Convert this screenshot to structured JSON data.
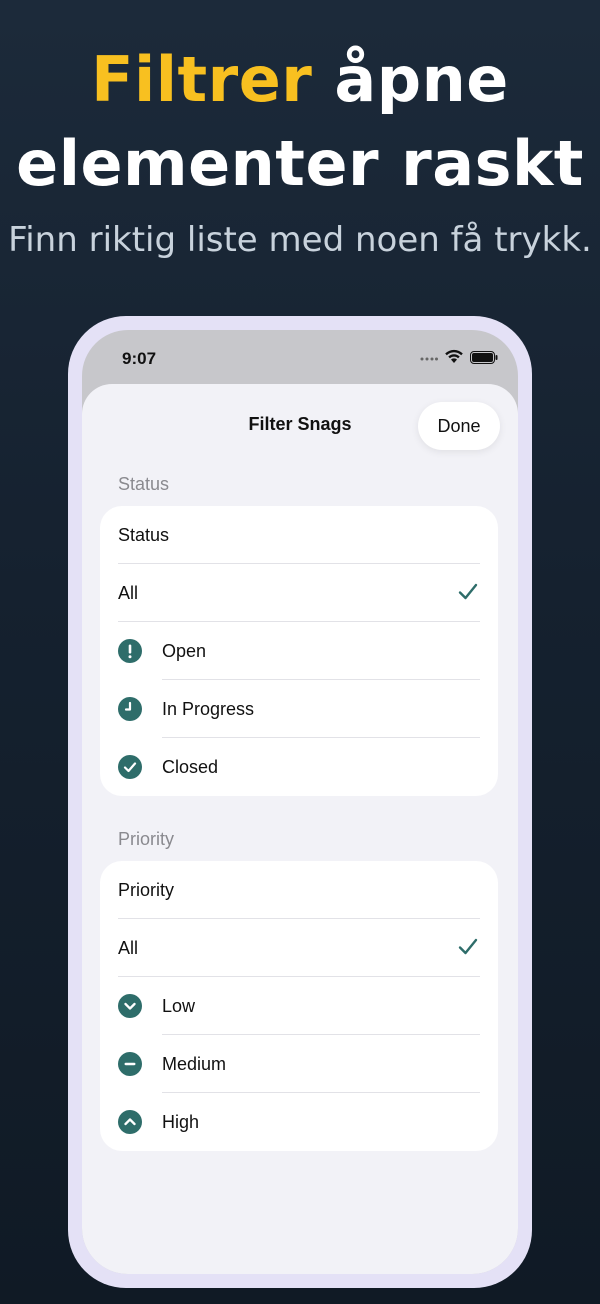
{
  "hero": {
    "headline_accent": "Filtrer",
    "headline_rest": " åpne",
    "headline_line2": "elementer raskt",
    "subtitle": "Finn riktig liste med noen få trykk."
  },
  "status_bar": {
    "time": "9:07"
  },
  "sheet": {
    "title": "Filter Snags",
    "done_label": "Done"
  },
  "status_section": {
    "label": "Status",
    "header": "Status",
    "all_label": "All",
    "all_selected": true,
    "options": [
      {
        "label": "Open",
        "icon": "exclamation-icon"
      },
      {
        "label": "In Progress",
        "icon": "clock-icon"
      },
      {
        "label": "Closed",
        "icon": "checkmark-icon"
      }
    ]
  },
  "priority_section": {
    "label": "Priority",
    "header": "Priority",
    "all_label": "All",
    "all_selected": true,
    "options": [
      {
        "label": "Low",
        "icon": "chevron-down-icon"
      },
      {
        "label": "Medium",
        "icon": "minus-icon"
      },
      {
        "label": "High",
        "icon": "chevron-up-icon"
      }
    ]
  },
  "colors": {
    "accent": "#f8c020",
    "icon_teal": "#2e6d6a",
    "background_top": "#1c2a3a",
    "phone_frame": "#e4e1f6"
  }
}
